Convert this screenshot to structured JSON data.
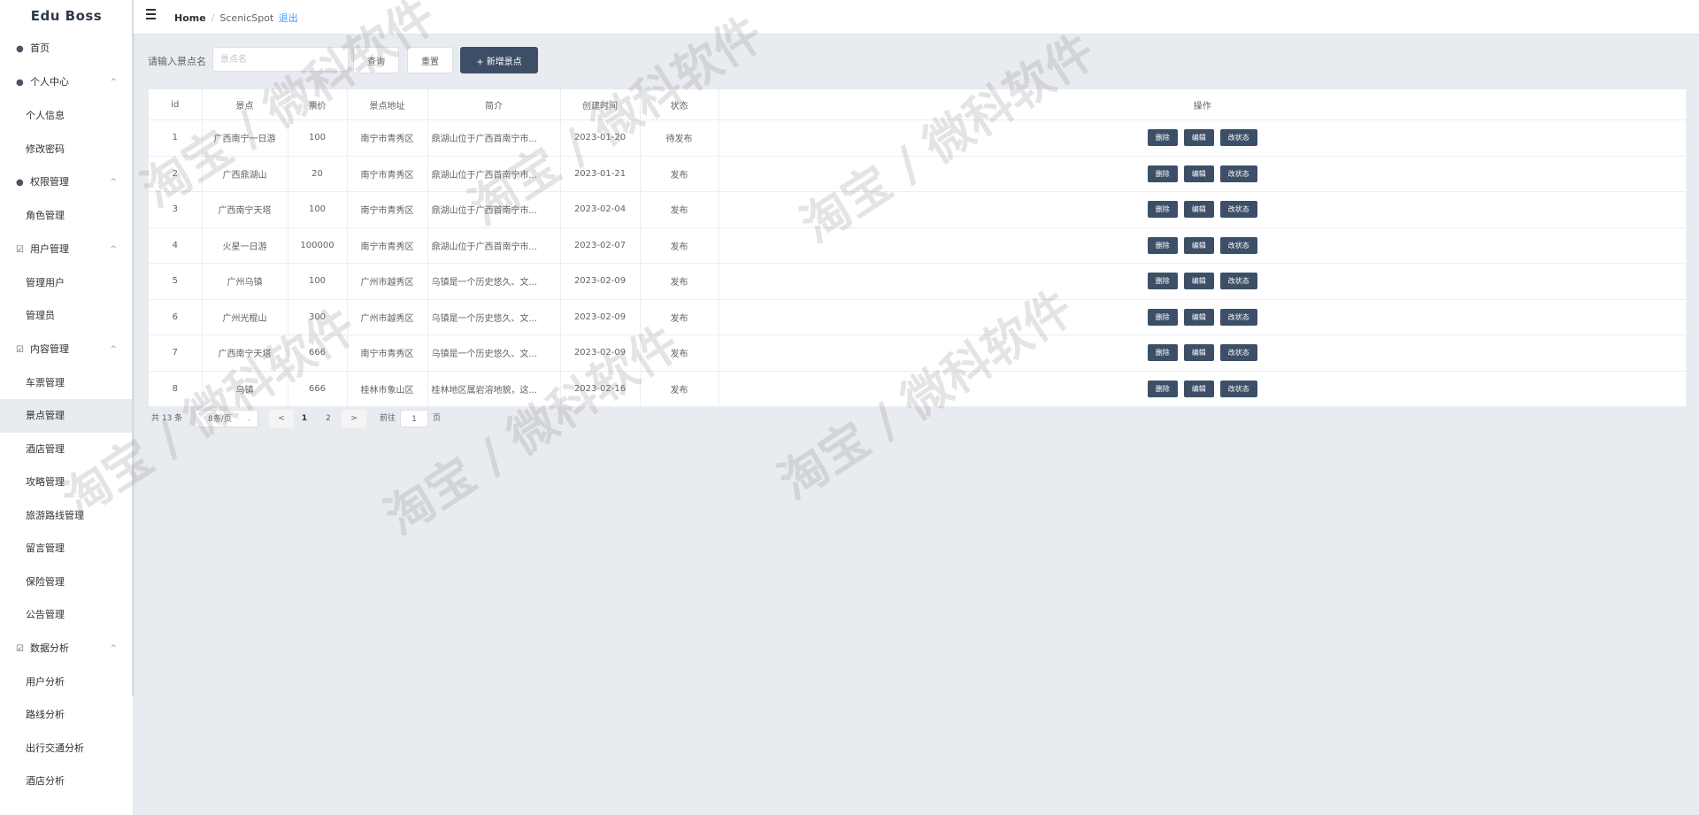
{
  "brand": "Edu Boss",
  "sidebar": {
    "items": [
      {
        "label": "首页",
        "kind": "top",
        "icon": "user-icon"
      },
      {
        "label": "个人中心",
        "kind": "top",
        "icon": "user-icon",
        "arrow": "^"
      },
      {
        "label": "个人信息",
        "kind": "sub"
      },
      {
        "label": "修改密码",
        "kind": "sub"
      },
      {
        "label": "权限管理",
        "kind": "top",
        "icon": "user-icon",
        "arrow": "^"
      },
      {
        "label": "角色管理",
        "kind": "sub"
      },
      {
        "label": "用户管理",
        "kind": "top",
        "icon": "check-box-icon",
        "arrow": "^"
      },
      {
        "label": "管理用户",
        "kind": "sub"
      },
      {
        "label": "管理员",
        "kind": "sub"
      },
      {
        "label": "内容管理",
        "kind": "top",
        "icon": "check-box-icon",
        "arrow": "^"
      },
      {
        "label": "车票管理",
        "kind": "sub"
      },
      {
        "label": "景点管理",
        "kind": "sub",
        "active": true
      },
      {
        "label": "酒店管理",
        "kind": "sub"
      },
      {
        "label": "攻略管理",
        "kind": "sub"
      },
      {
        "label": "旅游路线管理",
        "kind": "sub"
      },
      {
        "label": "留言管理",
        "kind": "sub"
      },
      {
        "label": "保险管理",
        "kind": "sub"
      },
      {
        "label": "公告管理",
        "kind": "sub"
      },
      {
        "label": "数据分析",
        "kind": "top",
        "icon": "check-box-icon",
        "arrow": "^"
      },
      {
        "label": "用户分析",
        "kind": "sub"
      },
      {
        "label": "路线分析",
        "kind": "sub"
      },
      {
        "label": "出行交通分析",
        "kind": "sub"
      },
      {
        "label": "酒店分析",
        "kind": "sub"
      }
    ]
  },
  "header": {
    "home": "Home",
    "separator": "/",
    "current": "ScenicSpot",
    "logout": "退出"
  },
  "search": {
    "label": "请输入景点名",
    "placeholder": "景点名",
    "query_label": "查询",
    "reset_label": "重置",
    "add_label": "+ 新增景点"
  },
  "table": {
    "columns": [
      "id",
      "景点",
      "票价",
      "景点地址",
      "简介",
      "创建时间",
      "状态",
      "操作"
    ],
    "actions": [
      "删除",
      "编辑",
      "改状态"
    ],
    "rows": [
      {
        "id": "1",
        "name": "广西南宁一日游",
        "price": "100",
        "address": "南宁市青秀区",
        "intro": "鼎湖山位于广西首南宁市...",
        "created": "2023-01-20",
        "status": "待发布"
      },
      {
        "id": "2",
        "name": "广西鼎湖山",
        "price": "20",
        "address": "南宁市青秀区",
        "intro": "鼎湖山位于广西首南宁市...",
        "created": "2023-01-21",
        "status": "发布"
      },
      {
        "id": "3",
        "name": "广西南宁天塔",
        "price": "100",
        "address": "南宁市青秀区",
        "intro": "鼎湖山位于广西首南宁市...",
        "created": "2023-02-04",
        "status": "发布"
      },
      {
        "id": "4",
        "name": "火星一日游",
        "price": "100000",
        "address": "南宁市青秀区",
        "intro": "鼎湖山位于广西首南宁市...",
        "created": "2023-02-07",
        "status": "发布"
      },
      {
        "id": "5",
        "name": "广州乌镇",
        "price": "100",
        "address": "广州市越秀区",
        "intro": "乌镇是一个历史悠久、文...",
        "created": "2023-02-09",
        "status": "发布"
      },
      {
        "id": "6",
        "name": "广州光棍山",
        "price": "300",
        "address": "广州市越秀区",
        "intro": "乌镇是一个历史悠久、文...",
        "created": "2023-02-09",
        "status": "发布"
      },
      {
        "id": "7",
        "name": "广西南宁天塔",
        "price": "666",
        "address": "南宁市青秀区",
        "intro": "乌镇是一个历史悠久、文...",
        "created": "2023-02-09",
        "status": "发布"
      },
      {
        "id": "8",
        "name": "乌镇",
        "price": "666",
        "address": "桂林市象山区",
        "intro": "桂林地区属岩溶地貌，这...",
        "created": "2023-02-16",
        "status": "发布"
      }
    ]
  },
  "pagination": {
    "total": "共 13 条",
    "page_size": "8条/页",
    "prev": "<",
    "pages": [
      "1",
      "2"
    ],
    "next": ">",
    "goto_prefix": "前往",
    "goto_value": "1",
    "goto_suffix": "页"
  },
  "watermark": "淘宝 / 微科软件"
}
